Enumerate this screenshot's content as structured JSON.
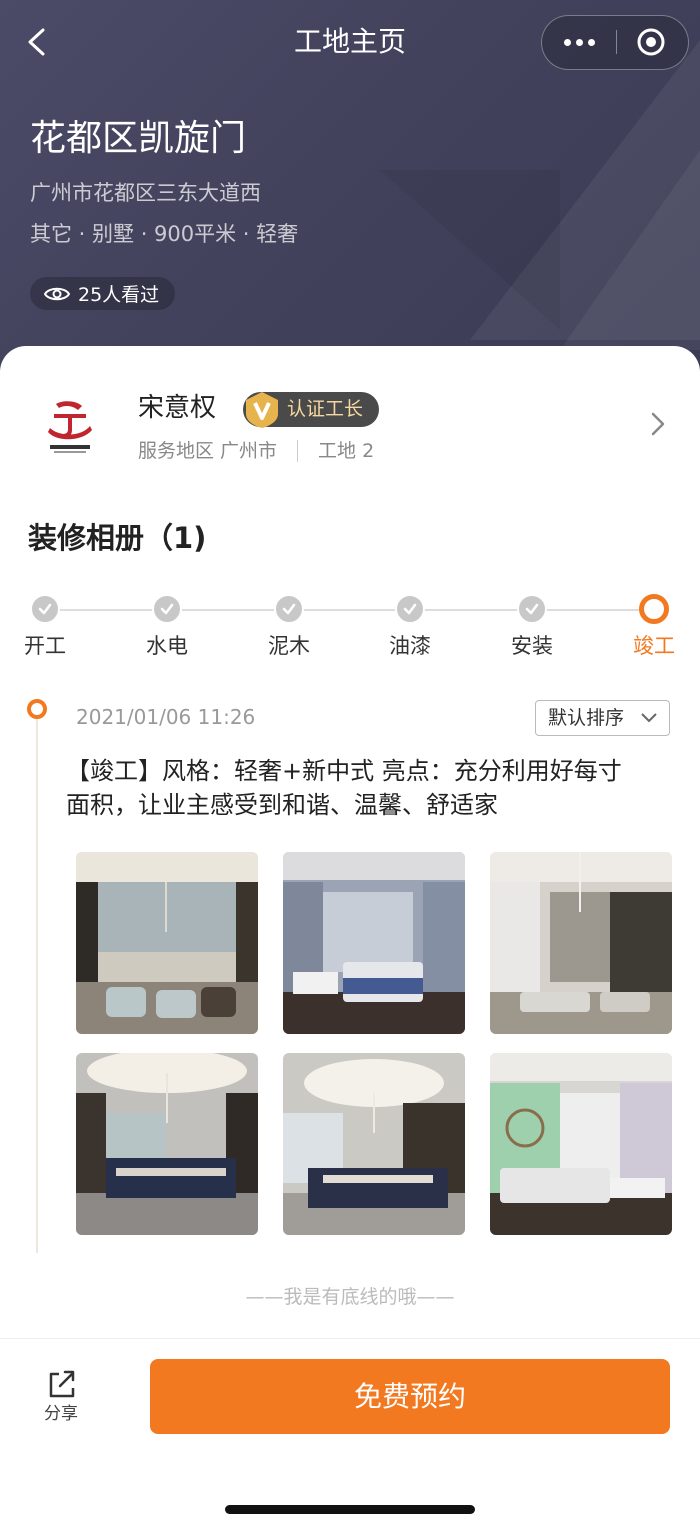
{
  "nav": {
    "title": "工地主页",
    "back_icon": "chevron-left-icon",
    "more_icon": "more-dots-icon",
    "close_icon": "target-circle-icon"
  },
  "site": {
    "name": "花都区凯旋门",
    "address": "广州市花都区三东大道西",
    "tags": "其它 · 别墅 · 900平米 · 轻奢",
    "views": "25人看过"
  },
  "owner": {
    "logo_icon": "company-logo-icon",
    "name": "宋意权",
    "badge": "认证工长",
    "service_area": "服务地区 广州市",
    "sites": "工地 2"
  },
  "album": {
    "title": "装修相册（1)"
  },
  "stages": [
    {
      "label": "开工",
      "status": "done"
    },
    {
      "label": "水电",
      "status": "done"
    },
    {
      "label": "泥木",
      "status": "done"
    },
    {
      "label": "油漆",
      "status": "done"
    },
    {
      "label": "安装",
      "status": "done"
    },
    {
      "label": "竣工",
      "status": "current"
    }
  ],
  "post": {
    "date": "2021/01/06 11:26",
    "sort_label": "默认排序",
    "text": "【竣工】风格：轻奢+新中式 亮点：充分利用好每寸面积，让业主感受到和谐、温馨、舒适家"
  },
  "footer": {
    "end_text": "——我是有底线的哦——",
    "share_label": "分享",
    "book_label": "免费预约"
  },
  "colors": {
    "accent": "#f37920",
    "hero_bg": "#44445e",
    "badge_bg": "#4a4a4a",
    "badge_text": "#f5d9a0"
  }
}
